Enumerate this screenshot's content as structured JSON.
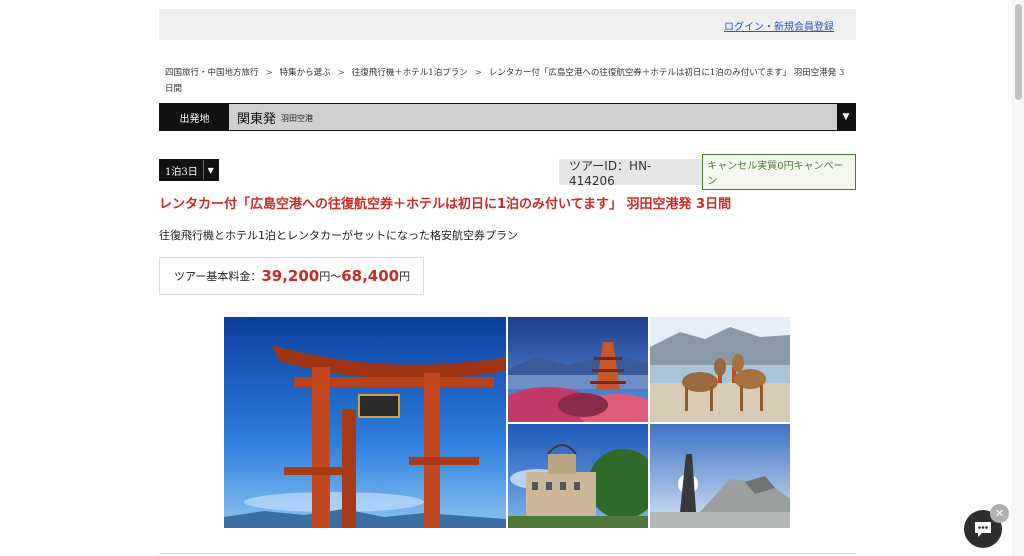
{
  "header": {
    "login_link": "ログイン・新規会員登録"
  },
  "breadcrumb": {
    "items": [
      "四国旅行・中国地方旅行",
      "特集から選ぶ",
      "往復飛行機＋ホテル1泊プラン",
      "レンタカー付「広島空港への往復航空券＋ホテルは初日に1泊のみ付いてます」 羽田空港発 3日間"
    ],
    "separator": ">"
  },
  "departure": {
    "label": "出発地",
    "selected": "関東発",
    "sub": "羽田空港",
    "arrow": "▼"
  },
  "duration": {
    "value": "1泊3日",
    "arrow": "▼"
  },
  "tour": {
    "id_text": "ツアーID：HN-414206",
    "cancel_badge": "キャンセル実質0円キャンペーン",
    "title": "レンタカー付「広島空港への往復航空券＋ホテルは初日に1泊のみ付いてます」 羽田空港発 3日間",
    "description": "往復飛行機とホテル1泊とレンタカーがセットになった格安航空券プラン"
  },
  "price": {
    "label": "ツアー基本料金：",
    "min": "39,200",
    "unit": "円",
    "tilde": "〜",
    "max": "68,400"
  },
  "chat": {
    "close": "✕"
  },
  "colors": {
    "accent_red": "#cc2a22",
    "badge_green": "#4c7a3a",
    "link_blue": "#2a5db0"
  }
}
